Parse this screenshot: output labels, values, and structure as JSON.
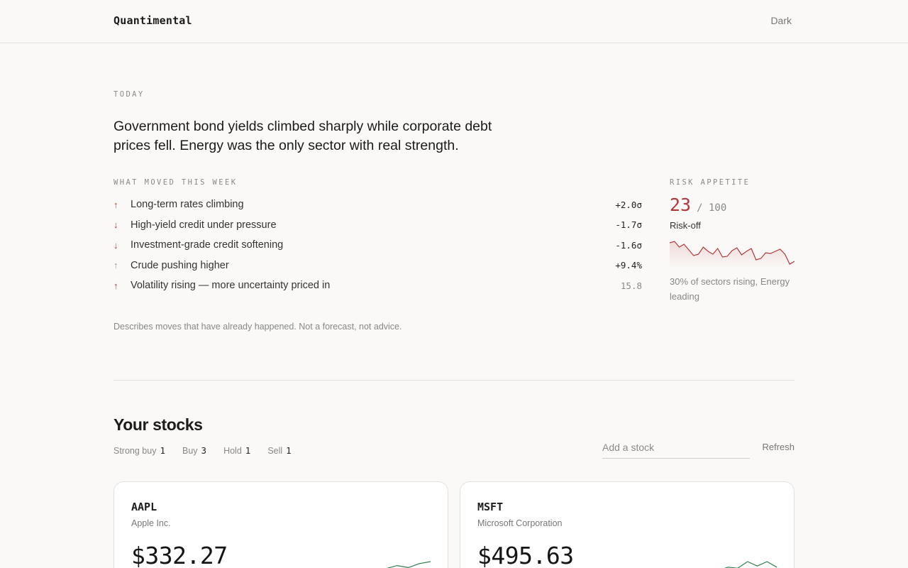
{
  "header": {
    "brand": "Quantimental",
    "theme_toggle": "Dark"
  },
  "today": {
    "label": "TODAY",
    "headline": "Government bond yields climbed sharply while corporate debt prices fell. Energy was the only sector with real strength."
  },
  "moves": {
    "label": "WHAT MOVED THIS WEEK",
    "items": [
      {
        "direction": "up",
        "icon": "arrow-up-icon",
        "label": "Long-term rates climbing",
        "value": "+2.0σ"
      },
      {
        "direction": "down",
        "icon": "arrow-down-icon",
        "label": "High-yield credit under pressure",
        "value": "-1.7σ"
      },
      {
        "direction": "down",
        "icon": "arrow-down-icon",
        "label": "Investment-grade credit softening",
        "value": "-1.6σ"
      },
      {
        "direction": "up",
        "icon": "arrow-up-icon",
        "label": "Crude pushing higher",
        "value": "+9.4%"
      },
      {
        "direction": "up",
        "icon": "arrow-up-icon",
        "label": "Volatility rising — more uncertainty priced in",
        "value": "15.8"
      }
    ]
  },
  "risk": {
    "label": "RISK APPETITE",
    "score": "23",
    "max": "/ 100",
    "state": "Risk-off",
    "note": "30% of sectors rising, Energy leading",
    "history": [
      52,
      54,
      46,
      50,
      42,
      34,
      36,
      46,
      40,
      36,
      44,
      32,
      33,
      41,
      45,
      35,
      40,
      44,
      28,
      30,
      38,
      37,
      40,
      43,
      36,
      22,
      26
    ],
    "color": "#b2383b"
  },
  "disclaimer": "Describes moves that have already happened. Not a forecast, not advice.",
  "stocks": {
    "title": "Your stocks",
    "ratings": [
      {
        "label": "Strong buy",
        "count": "1"
      },
      {
        "label": "Buy",
        "count": "3"
      },
      {
        "label": "Hold",
        "count": "1"
      },
      {
        "label": "Sell",
        "count": "1"
      }
    ],
    "add_placeholder": "Add a stock",
    "refresh_label": "Refresh",
    "cards": [
      {
        "ticker": "AAPL",
        "company": "Apple Inc.",
        "price": "$332.27",
        "trend": [
          20,
          22,
          18,
          24,
          30,
          26,
          34,
          38
        ],
        "color": "#2e7d4f"
      },
      {
        "ticker": "MSFT",
        "company": "Microsoft Corporation",
        "price": "$495.63",
        "trend": [
          22,
          26,
          24,
          30,
          28,
          40,
          32,
          40,
          30
        ],
        "color": "#2e7d4f"
      }
    ]
  }
}
